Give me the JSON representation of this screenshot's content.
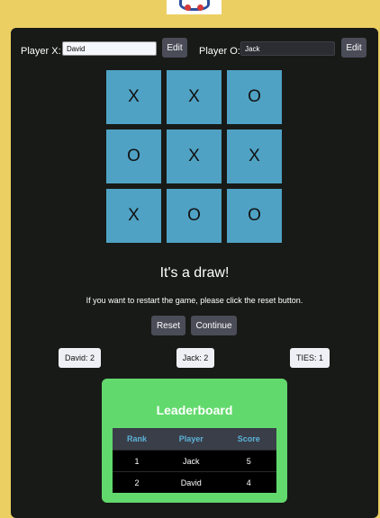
{
  "players": {
    "x_label": "Player X:",
    "x_name": "David",
    "o_label": "Player O:",
    "o_name": "Jack",
    "edit_label": "Edit"
  },
  "board": {
    "cells": [
      "X",
      "X",
      "O",
      "O",
      "X",
      "X",
      "X",
      "O",
      "O"
    ]
  },
  "status": {
    "message": "It's a draw!",
    "hint": "If you want to restart the game, please click the reset button."
  },
  "controls": {
    "reset_label": "Reset",
    "continue_label": "Continue"
  },
  "scores": {
    "x": "David: 2",
    "o": "Jack: 2",
    "ties": "TIES: 1"
  },
  "leaderboard": {
    "title": "Leaderboard",
    "headers": [
      "Rank",
      "Player",
      "Score"
    ],
    "rows": [
      [
        "1",
        "Jack",
        "5"
      ],
      [
        "2",
        "David",
        "4"
      ]
    ]
  },
  "colors": {
    "page_bg": "#eccf63",
    "panel_bg": "#181a17",
    "cell_bg": "#4fa2c4",
    "button_bg": "#4a4d58",
    "leaderboard_bg": "#62d96d",
    "table_header_text": "#5bb3d8"
  }
}
